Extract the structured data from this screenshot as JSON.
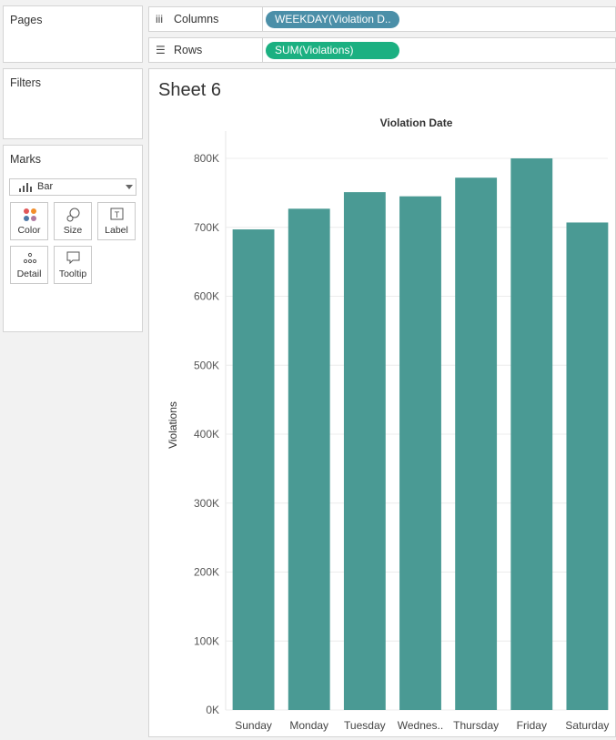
{
  "left_pane": {
    "pages_title": "Pages",
    "filters_title": "Filters",
    "marks_title": "Marks",
    "mark_type": "Bar",
    "mark_cards": [
      {
        "label": "Color",
        "icon": "color-dots-icon"
      },
      {
        "label": "Size",
        "icon": "size-icon"
      },
      {
        "label": "Label",
        "icon": "label-text-icon"
      },
      {
        "label": "Detail",
        "icon": "detail-dots-icon"
      },
      {
        "label": "Tooltip",
        "icon": "tooltip-bubble-icon"
      }
    ]
  },
  "shelves": {
    "columns": {
      "label": "Columns",
      "pill": "WEEKDAY(Violation D..",
      "pill_color": "#4b8fa8"
    },
    "rows": {
      "label": "Rows",
      "pill": "SUM(Violations)",
      "pill_color": "#1bb081"
    }
  },
  "sheet": {
    "title": "Sheet 6"
  },
  "chart_data": {
    "type": "bar",
    "title": "Violation Date",
    "xlabel": "",
    "ylabel": "Violations",
    "categories": [
      "Sunday",
      "Monday",
      "Tuesday",
      "Wednes..",
      "Thursday",
      "Friday",
      "Saturday"
    ],
    "values": [
      697000,
      727000,
      751000,
      745000,
      772000,
      800000,
      707000
    ],
    "ylim": [
      0,
      800000
    ],
    "yticks": [
      0,
      100000,
      200000,
      300000,
      400000,
      500000,
      600000,
      700000,
      800000
    ],
    "ytick_labels": [
      "0K",
      "100K",
      "200K",
      "300K",
      "400K",
      "500K",
      "600K",
      "700K",
      "800K"
    ],
    "bar_color": "#4a9a94",
    "grid": true
  }
}
